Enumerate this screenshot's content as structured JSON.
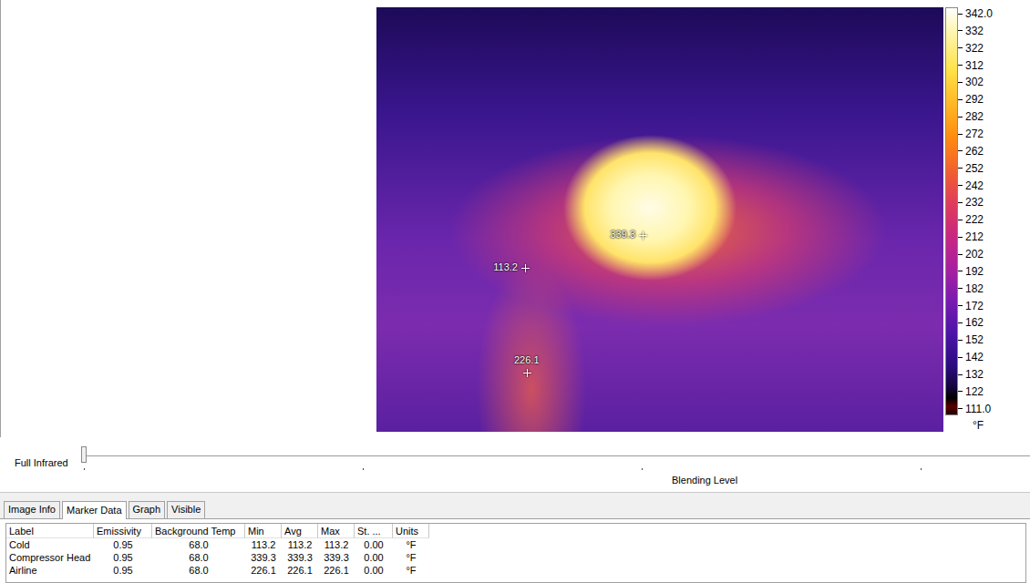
{
  "image": {
    "markers": [
      {
        "label": "339.3"
      },
      {
        "label": "113.2"
      },
      {
        "label": "226.1"
      }
    ]
  },
  "scale": {
    "ticks": [
      "342.0",
      "332",
      "322",
      "312",
      "302",
      "292",
      "282",
      "272",
      "262",
      "252",
      "242",
      "232",
      "222",
      "212",
      "202",
      "192",
      "182",
      "172",
      "162",
      "152",
      "142",
      "132",
      "122",
      "111.0"
    ],
    "unit": "°F"
  },
  "blend": {
    "label": "Full Infrared",
    "caption": "Blending Level",
    "level": 0.0
  },
  "tabs": [
    {
      "label": "Image Info",
      "selected": false
    },
    {
      "label": "Marker Data",
      "selected": true
    },
    {
      "label": "Graph",
      "selected": false
    },
    {
      "label": "Visible",
      "selected": false
    }
  ],
  "table": {
    "columns": [
      "Label",
      "Emissivity",
      "Background Temp",
      "Min",
      "Avg",
      "Max",
      "St. ...",
      "Units"
    ],
    "rows": [
      {
        "cells": [
          "Cold",
          "0.95",
          "68.0",
          "113.2",
          "113.2",
          "113.2",
          "0.00",
          "°F"
        ]
      },
      {
        "cells": [
          "Compressor Head",
          "0.95",
          "68.0",
          "339.3",
          "339.3",
          "339.3",
          "0.00",
          "°F"
        ]
      },
      {
        "cells": [
          "Airline",
          "0.95",
          "68.0",
          "226.1",
          "226.1",
          "226.1",
          "0.00",
          "°F"
        ]
      }
    ]
  }
}
